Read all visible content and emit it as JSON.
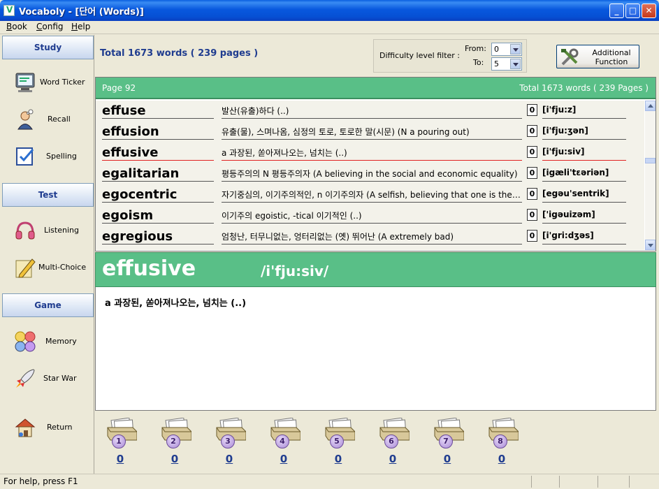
{
  "window": {
    "title": "Vocaboly - [단어 (Words)]"
  },
  "menu": [
    "Book",
    "Config",
    "Help"
  ],
  "sidebar": {
    "sections": {
      "study": "Study",
      "test": "Test",
      "game": "Game"
    },
    "items": {
      "word_ticker": "Word Ticker",
      "recall": "Recall",
      "spelling": "Spelling",
      "listening": "Listening",
      "multi_choice": "Multi-Choice",
      "memory": "Memory",
      "star_war": "Star War",
      "return": "Return"
    }
  },
  "summary": {
    "total_text": "Total 1673 words ( 239 pages )"
  },
  "filter": {
    "label": "Difficulty level filter :",
    "from_label": "From:",
    "to_label": "To:",
    "from_value": "0",
    "to_value": "5"
  },
  "additional": {
    "line1": "Additional",
    "line2": "Function"
  },
  "list_header": {
    "page": "Page 92",
    "total": "Total 1673 words ( 239 Pages )"
  },
  "words": [
    {
      "word": "effuse",
      "meaning": "발산(유출)하다 (..)",
      "count": "0",
      "pron": "[i'fju:z]"
    },
    {
      "word": "effusion",
      "meaning": "유출(물), 스며나옴, 심정의 토로, 토로한 말(시문) (N a pouring out)",
      "count": "0",
      "pron": "[i'fju:ʒən]"
    },
    {
      "word": "effusive",
      "meaning": "a 과장된, 쏟아져나오는, 넘치는 (..)",
      "count": "0",
      "pron": "[i'fju:siv]"
    },
    {
      "word": "egalitarian",
      "meaning": "평등주의의 N 평등주의자 (A believing in the social and economic equality)",
      "count": "0",
      "pron": "[igæli'tɛəriən]"
    },
    {
      "word": "egocentric",
      "meaning": "자기중심의, 이기주의적인, n 이기주의자 (A selfish, believing that one is the center)",
      "count": "0",
      "pron": "[egəu'sentrik]"
    },
    {
      "word": "egoism",
      "meaning": "이기주의 egoistic, -tical 이기적인 (..)",
      "count": "0",
      "pron": "['igəuizəm]"
    },
    {
      "word": "egregious",
      "meaning": "엄청난, 터무니없는, 엉터리없는 (옛) 뛰어난 (A extremely bad)",
      "count": "0",
      "pron": "[i'gri:dʒəs]"
    }
  ],
  "detail": {
    "word": "effusive",
    "pron": "/i'fju:siv/",
    "meaning": "a 과장된, 쏟아져나오는, 넘치는 (..)"
  },
  "boxes": [
    {
      "label": "1",
      "count": "0"
    },
    {
      "label": "2",
      "count": "0"
    },
    {
      "label": "3",
      "count": "0"
    },
    {
      "label": "4",
      "count": "0"
    },
    {
      "label": "5",
      "count": "0"
    },
    {
      "label": "6",
      "count": "0"
    },
    {
      "label": "7",
      "count": "0"
    },
    {
      "label": "8",
      "count": "0"
    }
  ],
  "status": {
    "text": "For help, press F1"
  },
  "colors": {
    "header_green": "#59bf87",
    "accent_blue": "#1f3c8f",
    "selected_underline": "#e02020"
  }
}
